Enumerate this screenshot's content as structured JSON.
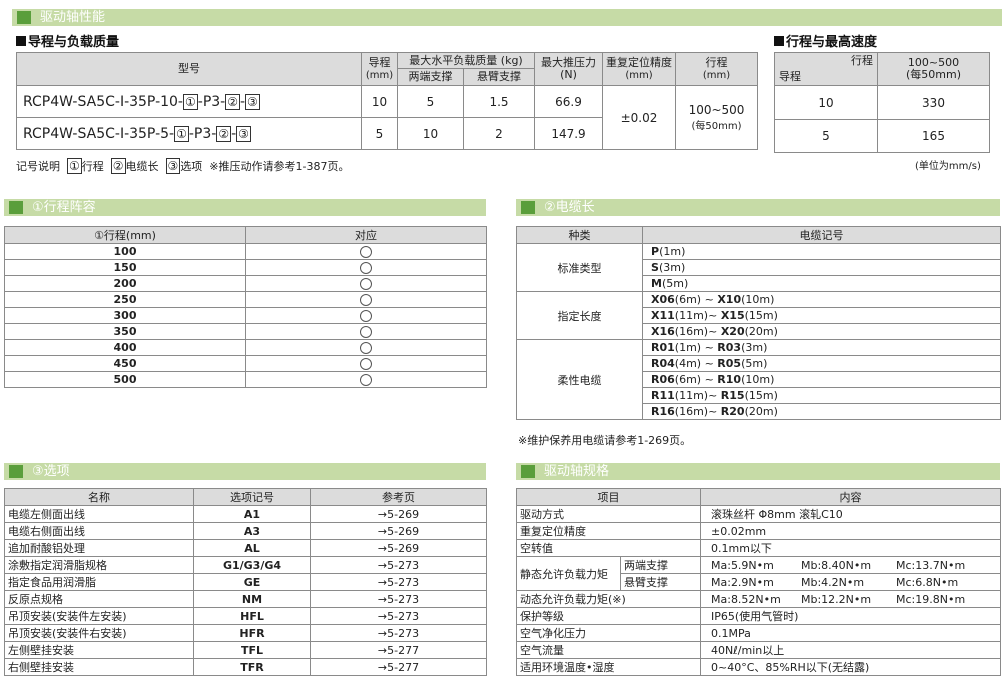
{
  "page_banner": "驱动轴性能",
  "lead_load": {
    "heading": "导程与负载质量",
    "headers": {
      "model": "型号",
      "lead": "导程",
      "lead_unit": "(mm)",
      "max_load": "最大水平负载质量 (kg)",
      "both_support": "两端支撑",
      "cantilever": "悬臂支撑",
      "max_thrust": "最大推压力",
      "max_thrust_unit": "(N)",
      "repeat": "重复定位精度",
      "repeat_unit": "(mm)",
      "stroke": "行程",
      "stroke_unit": "(mm)"
    },
    "rows": [
      {
        "model_prefix": "RCP4W-SA5C-I-35P-10-",
        "b1": "①",
        "mid": "-P3-",
        "b2": "②",
        "dash": "-",
        "b3": "③",
        "lead": "10",
        "both": "5",
        "cant": "1.5",
        "thrust": "66.9"
      },
      {
        "model_prefix": "RCP4W-SA5C-I-35P-5-",
        "b1": "①",
        "mid": "-P3-",
        "b2": "②",
        "dash": "-",
        "b3": "③",
        "lead": "5",
        "both": "10",
        "cant": "2",
        "thrust": "147.9"
      }
    ],
    "repeat_value": "±0.02",
    "stroke_value": "100~500",
    "stroke_sub": "(每50mm)",
    "legend": {
      "label": "记号说明",
      "i1": "①",
      "t1": "行程",
      "i2": "②",
      "t2": "电缆长",
      "i3": "③",
      "t3": "选项",
      "note": "※推压动作请参考1-387页。"
    }
  },
  "speed": {
    "heading": "行程与最高速度",
    "corner_top": "行程",
    "corner_bottom": "导程",
    "col": "100~500",
    "col_sub": "(每50mm)",
    "rows": [
      {
        "lead": "10",
        "speed": "330"
      },
      {
        "lead": "5",
        "speed": "165"
      }
    ],
    "unit": "(单位为mm/s)"
  },
  "stroke_table": {
    "banner": "①行程阵容",
    "headers": [
      "①行程(mm)",
      "对应"
    ],
    "rows": [
      "100",
      "150",
      "200",
      "250",
      "300",
      "350",
      "400",
      "450",
      "500"
    ]
  },
  "cable_table": {
    "banner": "②电缆长",
    "headers": [
      "种类",
      "电缆记号"
    ],
    "groups": [
      {
        "type": "标准类型",
        "rows": [
          {
            "code": "P",
            "len": "(1m)"
          },
          {
            "code": "S",
            "len": "(3m)"
          },
          {
            "code": "M",
            "len": "(5m)"
          }
        ]
      },
      {
        "type": "指定长度",
        "rows": [
          {
            "code": "X06",
            "len": "(6m)",
            "code2": "X10",
            "len2": "(10m)"
          },
          {
            "code": "X11",
            "len": "(11m)",
            "code2": "X15",
            "len2": "(15m)"
          },
          {
            "code": "X16",
            "len": "(16m)",
            "code2": "X20",
            "len2": "(20m)"
          }
        ]
      },
      {
        "type": "柔性电缆",
        "rows": [
          {
            "code": "R01",
            "len": "(1m)",
            "code2": "R03",
            "len2": "(3m)"
          },
          {
            "code": "R04",
            "len": "(4m)",
            "code2": "R05",
            "len2": "(5m)"
          },
          {
            "code": "R06",
            "len": "(6m)",
            "code2": "R10",
            "len2": "(10m)"
          },
          {
            "code": "R11",
            "len": "(11m)",
            "code2": "R15",
            "len2": "(15m)"
          },
          {
            "code": "R16",
            "len": "(16m)",
            "code2": "R20",
            "len2": "(20m)"
          }
        ]
      }
    ],
    "tilde": "~",
    "note": "※维护保养用电缆请参考1-269页。"
  },
  "options_table": {
    "banner": "③选项",
    "headers": [
      "名称",
      "选项记号",
      "参考页"
    ],
    "rows": [
      [
        "电缆左侧面出线",
        "A1",
        "→5-269"
      ],
      [
        "电缆右侧面出线",
        "A3",
        "→5-269"
      ],
      [
        "追加耐酸铝处理",
        "AL",
        "→5-269"
      ],
      [
        "涂敷指定润滑脂规格",
        "G1/G3/G4",
        "→5-273"
      ],
      [
        "指定食品用润滑脂",
        "GE",
        "→5-273"
      ],
      [
        "反原点规格",
        "NM",
        "→5-273"
      ],
      [
        "吊顶安装(安装件左安装)",
        "HFL",
        "→5-273"
      ],
      [
        "吊顶安装(安装件右安装)",
        "HFR",
        "→5-273"
      ],
      [
        "左侧壁挂安装",
        "TFL",
        "→5-277"
      ],
      [
        "右侧壁挂安装",
        "TFR",
        "→5-277"
      ]
    ]
  },
  "spec_table": {
    "banner": "驱动轴规格",
    "headers": [
      "项目",
      "内容"
    ],
    "rows": {
      "drive": [
        "驱动方式",
        "滚珠丝杆 Φ8mm  滚轧C10"
      ],
      "repeat": [
        "重复定位精度",
        "±0.02mm"
      ],
      "lost": [
        "空转值",
        "0.1mm以下"
      ],
      "static_label": "静态允许负载力矩",
      "static_both": [
        "两端支撑",
        "Ma:5.9N•m",
        "Mb:8.40N•m",
        "Mc:13.7N•m"
      ],
      "static_cant": [
        "悬臂支撑",
        "Ma:2.9N•m",
        "Mb:4.2N•m",
        "Mc:6.8N•m"
      ],
      "dynamic": [
        "动态允许负载力矩(※)",
        "Ma:8.52N•m",
        "Mb:12.2N•m",
        "Mc:19.8N•m"
      ],
      "protect": [
        "保护等级",
        "IP65(使用气管时)"
      ],
      "air_press": [
        "空气净化压力",
        "0.1MPa"
      ],
      "air_flow": [
        "空气流量",
        "40Nℓ/min以上"
      ],
      "env": [
        "适用环境温度•湿度",
        "0~40°C、85%RH以下(无结露)"
      ]
    }
  }
}
